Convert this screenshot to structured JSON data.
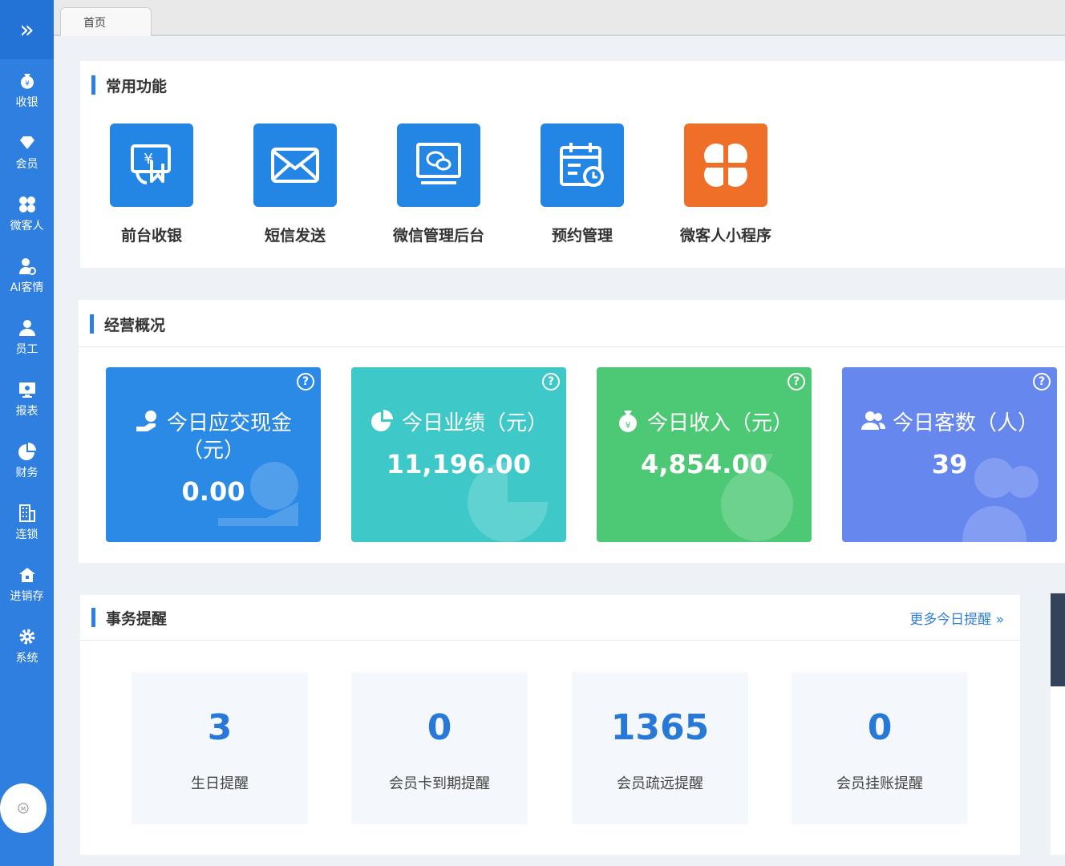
{
  "sidebar": {
    "items": [
      {
        "label": "收银",
        "icon": "yen-bag-icon"
      },
      {
        "label": "会员",
        "icon": "diamond-icon"
      },
      {
        "label": "微客人",
        "icon": "clover-icon"
      },
      {
        "label": "AI客情",
        "icon": "user-gear-icon"
      },
      {
        "label": "员工",
        "icon": "person-icon"
      },
      {
        "label": "报表",
        "icon": "monitor-icon"
      },
      {
        "label": "财务",
        "icon": "pie-chart-icon"
      },
      {
        "label": "连锁",
        "icon": "building-icon"
      },
      {
        "label": "进销存",
        "icon": "house-icon"
      },
      {
        "label": "系统",
        "icon": "gear-icon"
      }
    ]
  },
  "tabs": [
    {
      "label": "首页"
    }
  ],
  "common": {
    "title": "常用功能",
    "items": [
      {
        "label": "前台收银",
        "icon": "cashier-hand-icon",
        "color": "#2385e4"
      },
      {
        "label": "短信发送",
        "icon": "envelope-icon",
        "color": "#2385e4"
      },
      {
        "label": "微信管理后台",
        "icon": "wechat-monitor-icon",
        "color": "#2385e4"
      },
      {
        "label": "预约管理",
        "icon": "calendar-clock-icon",
        "color": "#2385e4"
      },
      {
        "label": "微客人小程序",
        "icon": "clover-icon",
        "color": "#f06f28"
      }
    ]
  },
  "overview": {
    "title": "经营概况",
    "cards": [
      {
        "label": "今日应交现金（元）",
        "value": "0.00",
        "icon": "hand-coin-icon",
        "color": "#2b8ae6"
      },
      {
        "label": "今日业绩（元）",
        "value": "11,196.00",
        "icon": "pie-chart-icon",
        "color": "#3ec8c8"
      },
      {
        "label": "今日收入（元）",
        "value": "4,854.00",
        "icon": "yen-bag-icon",
        "color": "#4dc975"
      },
      {
        "label": "今日客数（人）",
        "value": "39",
        "icon": "users-icon",
        "color": "#6688ee"
      }
    ]
  },
  "reminders": {
    "title": "事务提醒",
    "more": "更多今日提醒",
    "items": [
      {
        "value": "3",
        "label": "生日提醒"
      },
      {
        "value": "0",
        "label": "会员卡到期提醒"
      },
      {
        "value": "1365",
        "label": "会员疏远提醒"
      },
      {
        "value": "0",
        "label": "会员挂账提醒"
      }
    ]
  },
  "help_mark": "?"
}
